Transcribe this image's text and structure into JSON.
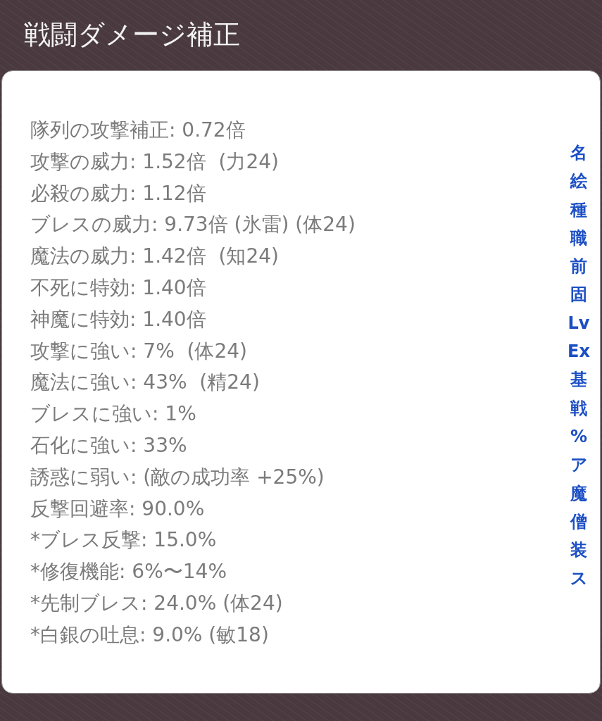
{
  "title": "戦闘ダメージ補正",
  "stats": [
    "隊列の攻撃補正: 0.72倍",
    "攻撃の威力: 1.52倍  (力24)",
    "必殺の威力: 1.12倍",
    "ブレスの威力: 9.73倍 (氷雷) (体24)",
    "魔法の威力: 1.42倍  (知24)",
    "不死に特効: 1.40倍",
    "神魔に特効: 1.40倍",
    "攻撃に強い: 7%  (体24)",
    "魔法に強い: 43%  (精24)",
    "ブレスに強い: 1%",
    "石化に強い: 33%",
    "誘惑に弱い: (敵の成功率 +25%)",
    "反撃回避率: 90.0%",
    "*ブレス反撃: 15.0%",
    "*修復機能: 6%〜14%",
    "*先制ブレス: 24.0% (体24)",
    "*白銀の吐息: 9.0% (敏18)"
  ],
  "index": [
    "名",
    "絵",
    "種",
    "職",
    "前",
    "固",
    "Lv",
    "Ex",
    "基",
    "戦",
    "%",
    "ア",
    "魔",
    "僧",
    "装",
    "ス"
  ]
}
